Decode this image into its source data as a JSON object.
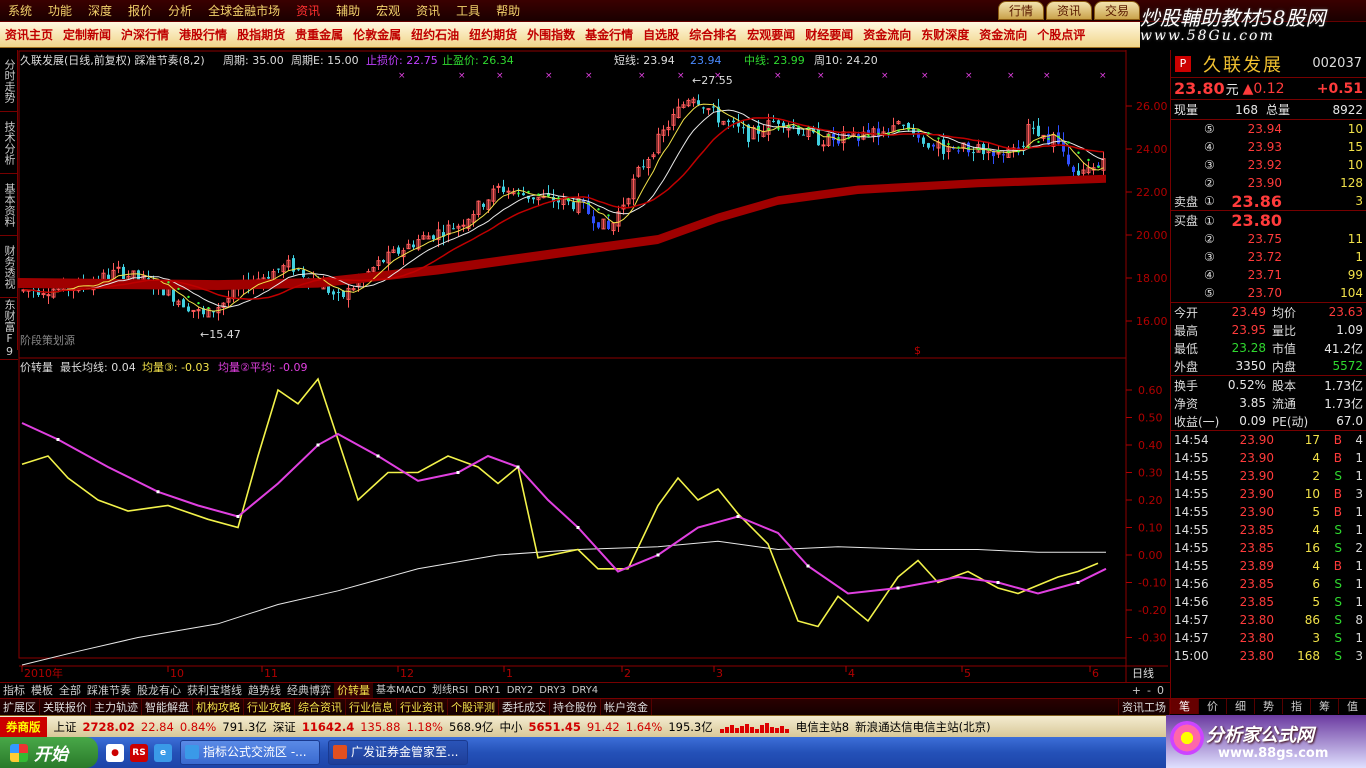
{
  "menubar": {
    "items": [
      "系统",
      "功能",
      "深度",
      "报价",
      "分析",
      "全球金融市场",
      "资讯",
      "辅助",
      "宏观",
      "资讯",
      "工具",
      "帮助"
    ],
    "active_index": 6,
    "tabs": [
      "行情",
      "资讯",
      "交易"
    ]
  },
  "watermark": {
    "title": "炒股輔助教材58股网",
    "url": "www.58Gu.com"
  },
  "newsbar": {
    "items": [
      "资讯主页",
      "定制新闻",
      "沪深行情",
      "港股行情",
      "股指期货",
      "贵重金属",
      "伦敦金属",
      "纽约石油",
      "纽约期货",
      "外围指数",
      "基金行情",
      "自选股",
      "综合排名",
      "宏观要闻",
      "财经要闻",
      "资金流向",
      "东财深度",
      "资金流向",
      "个股点评"
    ]
  },
  "vtabs": [
    "分时走势",
    "技术分析",
    "基本资料",
    "财务透视",
    "东财富F9"
  ],
  "main_chart": {
    "legend": {
      "title": "久联发展(日线,前复权) 踩准节奏(8,2)",
      "period_label": "周期: 35.00",
      "period_e": "周期E: 15.00",
      "stop_loss": "止损价: 22.75",
      "take_profit": "止盈价: 26.34",
      "short_line": "短线: 23.94",
      "short_val": "23.94",
      "mid_line": "中线: 23.99",
      "week10": "周10: 24.20"
    },
    "annotations": {
      "high": "27.55",
      "low": "15.47"
    },
    "y_ticks": [
      "26.00",
      "24.00",
      "22.00",
      "20.00",
      "18.00",
      "16.00"
    ],
    "bottom_label": "阶段策划源"
  },
  "sub_chart": {
    "legend": {
      "name": "价转量",
      "longest": "最长均线: 0.04",
      "avg3": "均量③: -0.03",
      "avg2": "均量②平均: -0.09"
    },
    "y_ticks": [
      "0.60",
      "0.50",
      "0.40",
      "0.30",
      "0.20",
      "0.10",
      "0.00",
      "-0.10",
      "-0.20",
      "-0.30"
    ]
  },
  "x_axis": {
    "labels": [
      "2010年",
      "10",
      "11",
      "12",
      "1",
      "2",
      "3",
      "4",
      "5",
      "6"
    ],
    "right_label": "日线"
  },
  "formula_tabs": {
    "items": [
      "指标",
      "模板",
      "全部",
      "踩准节奏",
      "股龙有心",
      "获利宝塔线",
      "趋势线",
      "经典博弈",
      "价转量",
      "基本MACD",
      "划线RSI",
      "DRY1",
      "DRY2",
      "DRY3",
      "DRY4"
    ],
    "active_index": 8,
    "controls": [
      "+",
      "-",
      "0"
    ]
  },
  "func_tabs": {
    "items": [
      "扩展区",
      "关联报价",
      "主力轨迹",
      "智能解盘",
      "机构攻略",
      "行业攻略",
      "综合资讯",
      "行业信息",
      "行业资讯",
      "个股评测",
      "委托成交",
      "持仓股份",
      "帐户资金"
    ],
    "right": "资讯工场"
  },
  "quote": {
    "badge": "P",
    "name": "久联发展",
    "code": "002037",
    "price": "23.80",
    "unit": "元",
    "change": "▲0.12",
    "pct": "+0.51",
    "now_vol_label": "现量",
    "now_vol": "168",
    "total_label": "总量",
    "total": "8922",
    "asks": [
      {
        "n": "⑤",
        "p": "23.94",
        "v": "10"
      },
      {
        "n": "④",
        "p": "23.93",
        "v": "15"
      },
      {
        "n": "③",
        "p": "23.92",
        "v": "10"
      },
      {
        "n": "②",
        "p": "23.90",
        "v": "128"
      }
    ],
    "ask1": {
      "label": "卖盘",
      "n": "①",
      "p": "23.86",
      "v": "3"
    },
    "bid1": {
      "label": "买盘",
      "n": "①",
      "p": "23.80",
      "v": ""
    },
    "bids": [
      {
        "n": "②",
        "p": "23.75",
        "v": "11"
      },
      {
        "n": "③",
        "p": "23.72",
        "v": "1"
      },
      {
        "n": "④",
        "p": "23.71",
        "v": "99"
      },
      {
        "n": "⑤",
        "p": "23.70",
        "v": "104"
      }
    ],
    "stats": [
      {
        "l1": "今开",
        "v1": "23.49",
        "l2": "均价",
        "v2": "23.63"
      },
      {
        "l1": "最高",
        "v1": "23.95",
        "l2": "量比",
        "v2": "1.09"
      },
      {
        "l1": "最低",
        "v1": "23.28",
        "l2": "市值",
        "v2": "41.2亿"
      },
      {
        "l1": "外盘",
        "v1": "3350",
        "l2": "内盘",
        "v2": "5572"
      }
    ],
    "stats2": [
      {
        "l1": "换手",
        "v1": "0.52%",
        "l2": "股本",
        "v2": "1.73亿"
      },
      {
        "l1": "净资",
        "v1": "3.85",
        "l2": "流通",
        "v2": "1.73亿"
      },
      {
        "l1": "收益(一)",
        "v1": "0.09",
        "l2": "PE(动)",
        "v2": "67.0"
      }
    ],
    "ticks": [
      {
        "t": "14:54",
        "p": "23.90",
        "v": "17",
        "bs": "B",
        "n": "4"
      },
      {
        "t": "14:55",
        "p": "23.90",
        "v": "4",
        "bs": "B",
        "n": "1"
      },
      {
        "t": "14:55",
        "p": "23.90",
        "v": "2",
        "bs": "S",
        "n": "1"
      },
      {
        "t": "14:55",
        "p": "23.90",
        "v": "10",
        "bs": "B",
        "n": "3"
      },
      {
        "t": "14:55",
        "p": "23.90",
        "v": "5",
        "bs": "B",
        "n": "1"
      },
      {
        "t": "14:55",
        "p": "23.85",
        "v": "4",
        "bs": "S",
        "n": "1"
      },
      {
        "t": "14:55",
        "p": "23.85",
        "v": "16",
        "bs": "S",
        "n": "2"
      },
      {
        "t": "14:55",
        "p": "23.89",
        "v": "4",
        "bs": "B",
        "n": "1"
      },
      {
        "t": "14:56",
        "p": "23.85",
        "v": "6",
        "bs": "S",
        "n": "1"
      },
      {
        "t": "14:56",
        "p": "23.85",
        "v": "5",
        "bs": "S",
        "n": "1"
      },
      {
        "t": "14:57",
        "p": "23.80",
        "v": "86",
        "bs": "S",
        "n": "8"
      },
      {
        "t": "14:57",
        "p": "23.80",
        "v": "3",
        "bs": "S",
        "n": "1"
      },
      {
        "t": "15:00",
        "p": "23.80",
        "v": "168",
        "bs": "S",
        "n": "3"
      }
    ],
    "bottom_tabs": [
      "笔",
      "价",
      "细",
      "势",
      "指",
      "筹",
      "值"
    ]
  },
  "index_bar": {
    "logo": "券商版",
    "items": [
      {
        "name": "上证",
        "val": "2728.02",
        "chg": "22.84",
        "pct": "0.84%",
        "amt": "791.3亿"
      },
      {
        "name": "深证",
        "val": "11642.4",
        "chg": "135.88",
        "pct": "1.18%",
        "amt": "568.9亿"
      },
      {
        "name": "中小",
        "val": "5651.45",
        "chg": "91.42",
        "pct": "1.64%",
        "amt": "195.3亿"
      }
    ],
    "server": "电信主站8",
    "server_name": "新浪通达信电信主站(北京)"
  },
  "taskbar": {
    "start": "开始",
    "tasks": [
      "指标公式交流区 -...",
      "广发证券金管家至..."
    ]
  },
  "brand": {
    "title": "分析家公式网",
    "url": "www.88gs.com"
  }
}
